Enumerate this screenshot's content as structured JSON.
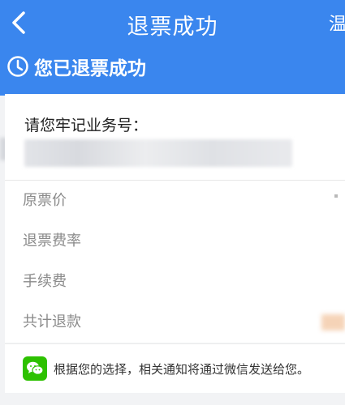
{
  "header": {
    "title": "退票成功",
    "right_action": "温",
    "status": "您已退票成功"
  },
  "card": {
    "label": "请您牢记业务号："
  },
  "fees": [
    {
      "label": "原票价"
    },
    {
      "label": "退票费率"
    },
    {
      "label": "手续费"
    },
    {
      "label": "共计退款"
    }
  ],
  "notice": {
    "text": "根据您的选择，相关通知将通过微信发送给您。"
  },
  "colors": {
    "header_bg": "#3a86ee",
    "wechat_green": "#2dc100"
  },
  "icons": {
    "back": "chevron-left-icon",
    "status": "clock-icon",
    "notice": "wechat-icon"
  }
}
